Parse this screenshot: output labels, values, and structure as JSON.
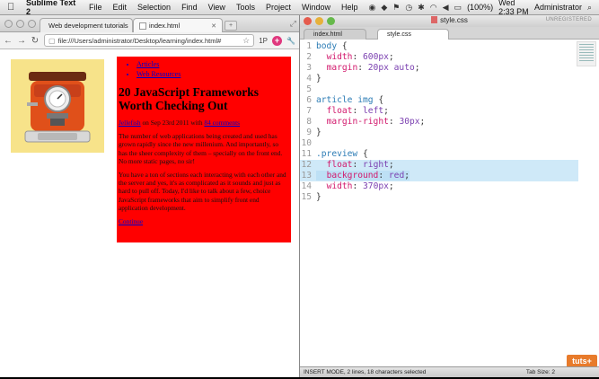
{
  "menubar": {
    "app_name": "Sublime Text 2",
    "items": [
      "File",
      "Edit",
      "Selection",
      "Find",
      "View",
      "Tools",
      "Project",
      "Window",
      "Help"
    ],
    "battery": "(100%)",
    "clock": "Wed 2:33 PM",
    "user": "Administrator"
  },
  "browser": {
    "tabs": [
      {
        "label": "Web development tutorials",
        "icon": "envato-icon",
        "active": false
      },
      {
        "label": "index.html",
        "icon": "page-icon",
        "active": true
      }
    ],
    "url": "file:///Users/administrator/Desktop/learning/index.html#",
    "ext_label": "1P",
    "page": {
      "nav_links": [
        "Articles",
        "Web Resources"
      ],
      "heading": "20 JavaScript Frameworks Worth Checking Out",
      "byline_author": "Jellefish",
      "byline_mid": " on Sep 23rd 2011 with ",
      "byline_comments": "84 comments",
      "para1": "The number of web applications being created and used has grown rapidly since the new millenium. And importantly, so has the sheer complexity of them – specially on the front end. No more static pages, no sir!",
      "para2": "You have a ton of sections each interacting with each other and the server and yes, it's as complicated as it sounds and just as hard to pull off. Today, I'd like to talk about a few, choice JavaScript frameworks that aim to simplify front end application development.",
      "more_link": "Continue"
    }
  },
  "sublime": {
    "title": "style.css",
    "unregistered": "UNREGISTERED",
    "tabs": [
      {
        "label": "index.html",
        "active": false
      },
      {
        "label": "style.css",
        "active": true
      }
    ],
    "lines": [
      {
        "n": "1",
        "text": "body {"
      },
      {
        "n": "2",
        "text": "  width: 600px;"
      },
      {
        "n": "3",
        "text": "  margin: 20px auto;"
      },
      {
        "n": "4",
        "text": "}"
      },
      {
        "n": "5",
        "text": ""
      },
      {
        "n": "6",
        "text": "article img {"
      },
      {
        "n": "7",
        "text": "  float: left;"
      },
      {
        "n": "8",
        "text": "  margin-right: 30px;"
      },
      {
        "n": "9",
        "text": "}"
      },
      {
        "n": "10",
        "text": ""
      },
      {
        "n": "11",
        "text": ".preview {"
      },
      {
        "n": "12",
        "text": "  float: right;"
      },
      {
        "n": "13",
        "text": "  background: red;"
      },
      {
        "n": "14",
        "text": "  width: 370px;"
      },
      {
        "n": "15",
        "text": "}"
      }
    ],
    "status": "INSERT MODE, 2 lines, 18 characters selected",
    "tab_size": "Tab Size: 2",
    "logo": "tuts+"
  },
  "colors": {
    "article_bg": "#ff0000",
    "image_bg": "#f7e38a",
    "selection": "#bde0f5"
  }
}
